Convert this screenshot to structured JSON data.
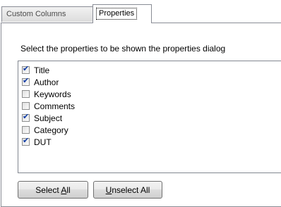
{
  "tabs": [
    {
      "label": "Custom Columns",
      "active": false
    },
    {
      "label": "Properties",
      "active": true
    }
  ],
  "instruction": "Select the properties to be shown the properties dialog",
  "properties": [
    {
      "label": "Title",
      "checked": true
    },
    {
      "label": "Author",
      "checked": true
    },
    {
      "label": "Keywords",
      "checked": false
    },
    {
      "label": "Comments",
      "checked": false
    },
    {
      "label": "Subject",
      "checked": true
    },
    {
      "label": "Category",
      "checked": false
    },
    {
      "label": "DUT",
      "checked": true
    }
  ],
  "buttons": {
    "select_all": {
      "prefix": "Select ",
      "mnemonic": "A",
      "suffix": "ll"
    },
    "unselect_all": {
      "prefix": "",
      "mnemonic": "U",
      "suffix": "nselect All"
    }
  },
  "colors": {
    "checkmark": "#0a3aa5",
    "border": "#898c95"
  }
}
